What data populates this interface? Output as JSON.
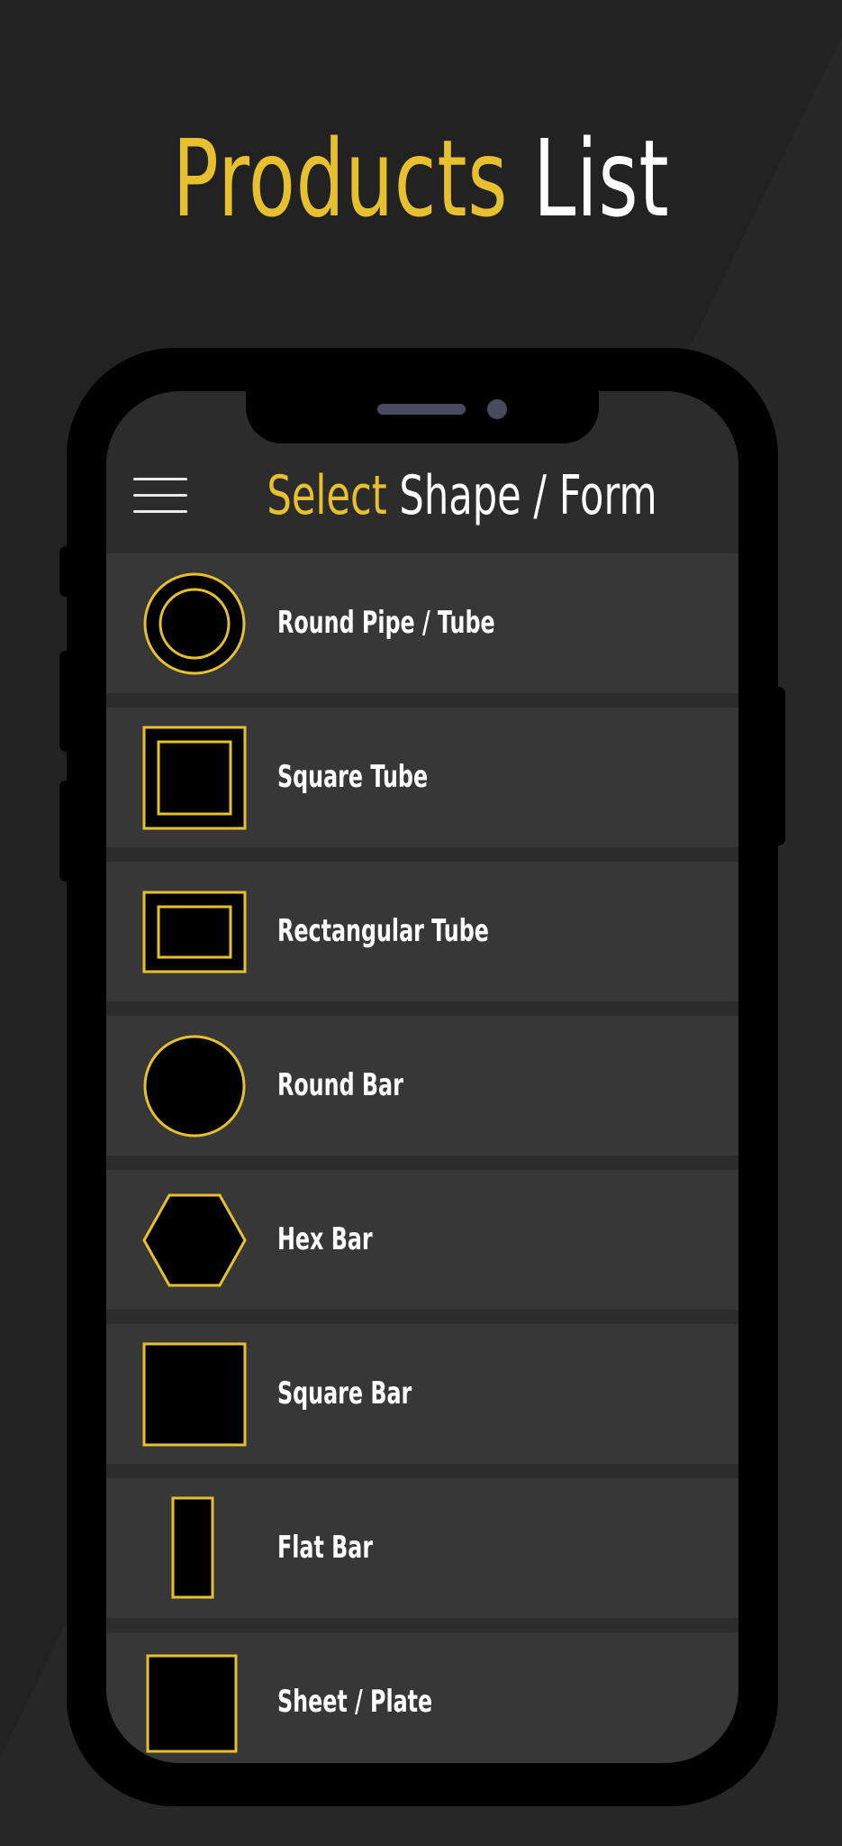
{
  "headline": {
    "word1": "Products",
    "word2": "List"
  },
  "app": {
    "header": {
      "title_highlight": "Select",
      "title_rest": "Shape / Form"
    },
    "items": [
      {
        "label": "Round Pipe / Tube",
        "icon": "round-pipe-icon"
      },
      {
        "label": "Square Tube",
        "icon": "square-tube-icon"
      },
      {
        "label": "Rectangular Tube",
        "icon": "rectangular-tube-icon"
      },
      {
        "label": "Round Bar",
        "icon": "round-bar-icon"
      },
      {
        "label": "Hex Bar",
        "icon": "hex-bar-icon"
      },
      {
        "label": "Square Bar",
        "icon": "square-bar-icon"
      },
      {
        "label": "Flat Bar",
        "icon": "flat-bar-icon"
      },
      {
        "label": "Sheet / Plate",
        "icon": "sheet-plate-icon"
      }
    ]
  },
  "colors": {
    "accent": "#e7c02f",
    "background": "#222222",
    "screen": "#2c2c2c",
    "row": "#373737",
    "text": "#ffffff"
  }
}
